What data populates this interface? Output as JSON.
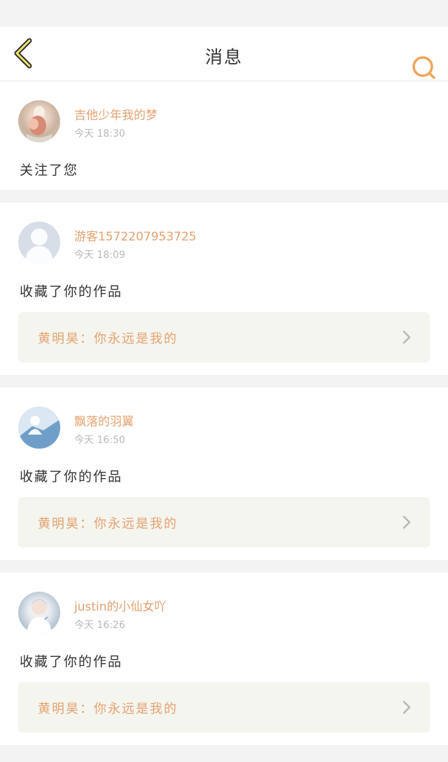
{
  "header": {
    "title": "消息",
    "back_icon": "chevron-left-icon",
    "search_icon": "search-icon",
    "accent": "#f0a45a"
  },
  "messages": [
    {
      "user": "吉他少年我的梦",
      "time": "今天 18:30",
      "action": "关注了您"
    },
    {
      "user": "游客1572207953725",
      "time": "今天 18:09",
      "action": "收藏了你的作品",
      "work": "黄明昊：你永远是我的"
    },
    {
      "user": "飘落的羽翼",
      "time": "今天 16:50",
      "action": "收藏了你的作品",
      "work": "黄明昊：你永远是我的"
    },
    {
      "user": "justin的小仙女吖",
      "time": "今天 16:26",
      "action": "收藏了你的作品",
      "work": "黄明昊：你永远是我的"
    }
  ],
  "colors": {
    "name": "#e5a170",
    "time": "#b8b8b8",
    "text": "#333333",
    "card_bg": "#ffffff",
    "work_bg": "#f4f5ee"
  }
}
